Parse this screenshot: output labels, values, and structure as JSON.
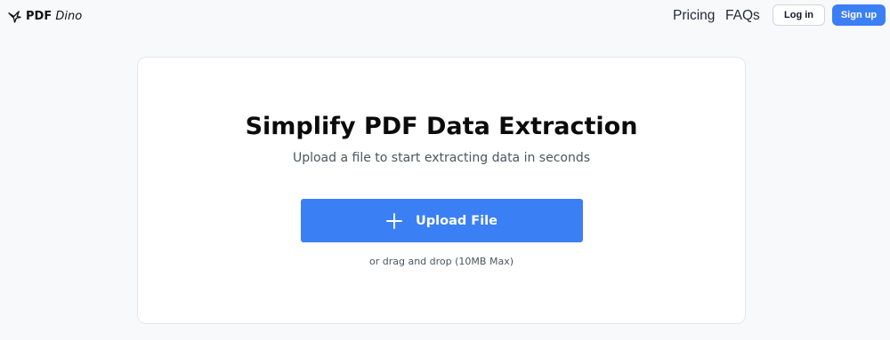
{
  "header": {
    "logo": {
      "icon": "pterodactyl-icon",
      "brand_bold": "PDF",
      "brand_italic": "Dino"
    },
    "nav": {
      "pricing_label": "Pricing",
      "faqs_label": "FAQs"
    },
    "login_label": "Log in",
    "signup_label": "Sign up"
  },
  "main": {
    "title": "Simplify PDF Data Extraction",
    "subtitle": "Upload a file to start extracting data in seconds",
    "upload_button": {
      "icon": "plus-icon",
      "label": "Upload File"
    },
    "drag_hint": "or drag and drop (10MB Max)"
  },
  "colors": {
    "accent": "#3b7ff5",
    "background": "#f8f9fb",
    "card": "#ffffff"
  }
}
